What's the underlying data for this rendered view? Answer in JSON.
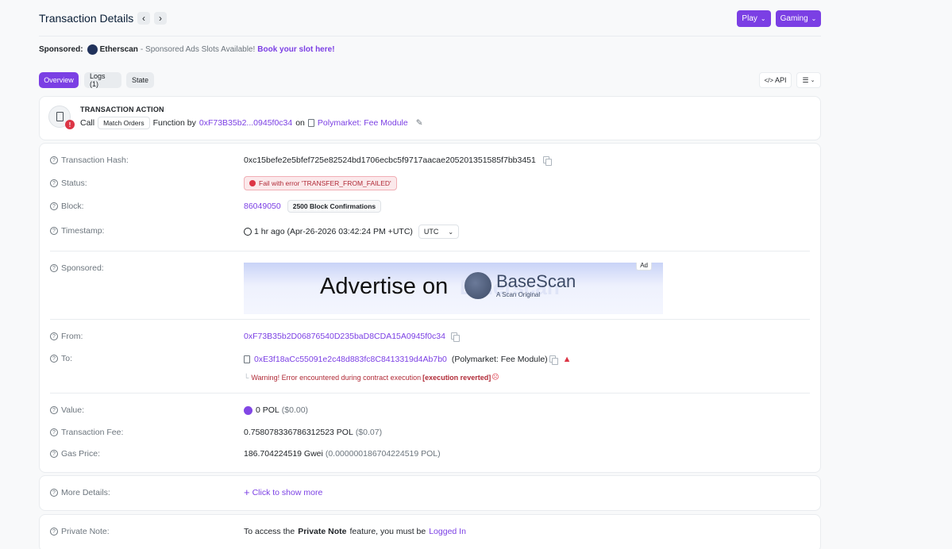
{
  "header": {
    "title": "Transaction Details",
    "prev_label": "‹",
    "next_label": "›",
    "play_label": "Play",
    "gaming_label": "Gaming"
  },
  "sponsored_bar": {
    "label": "Sponsored:",
    "brand": "Etherscan",
    "text": "- Sponsored Ads Slots Available!",
    "link": "Book your slot here!"
  },
  "tabs": [
    {
      "label": "Overview",
      "active": true
    },
    {
      "label": "Logs (1)",
      "active": false
    },
    {
      "label": "State",
      "active": false
    }
  ],
  "toolbar": {
    "api_label": "API"
  },
  "action": {
    "title": "TRANSACTION ACTION",
    "call": "Call",
    "method": "Match Orders",
    "function_by": "Function by",
    "address": "0xF73B35b2...0945f0c34",
    "on": "on",
    "contract": "Polymarket: Fee Module"
  },
  "rows": {
    "hash": {
      "label": "Transaction Hash:",
      "value": "0xc15befe2e5bfef725e82524bd1706ecbc5f9717aacae205201351585f7bb3451"
    },
    "status": {
      "label": "Status:",
      "value": "Fail with error 'TRANSFER_FROM_FAILED'"
    },
    "block": {
      "label": "Block:",
      "value": "86049050",
      "confirmations": "2500 Block Confirmations"
    },
    "timestamp": {
      "label": "Timestamp:",
      "value": "1 hr ago (Apr-26-2026 03:42:24 PM +UTC)",
      "tz": "UTC"
    },
    "sponsored": {
      "label": "Sponsored:",
      "ad_text": "Advertise on",
      "ad_brand": "BaseScan",
      "ad_sub": "A Scan Original",
      "ad_ghost": "Etherscan",
      "ad_tag": "Ad"
    },
    "from": {
      "label": "From:",
      "value": "0xF73B35b2D06876540D235baD8CDA15A0945f0c34"
    },
    "to": {
      "label": "To:",
      "value": "0xE3f18aCc55091e2c48d883fc8C8413319d4Ab7b0",
      "name": "(Polymarket: Fee Module)",
      "warning": "Warning! Error encountered during contract execution",
      "reverted": "[execution reverted]",
      "tree_glyph": "└"
    },
    "value": {
      "label": "Value:",
      "amount": "0 POL",
      "usd": "($0.00)"
    },
    "fee": {
      "label": "Transaction Fee:",
      "amount": "0.758078336786312523 POL",
      "usd": "($0.07)"
    },
    "gas": {
      "label": "Gas Price:",
      "amount": "186.704224519 Gwei",
      "pol": "(0.000000186704224519 POL)"
    },
    "more": {
      "label": "More Details:",
      "value": "Click to show more"
    },
    "note": {
      "label": "Private Note:",
      "prefix": "To access the",
      "bold": "Private Note",
      "middle": "feature, you must be",
      "link": "Logged In"
    }
  },
  "colors": {
    "accent": "#7b3fe4",
    "danger": "#dc3545",
    "muted": "#6c757d"
  }
}
